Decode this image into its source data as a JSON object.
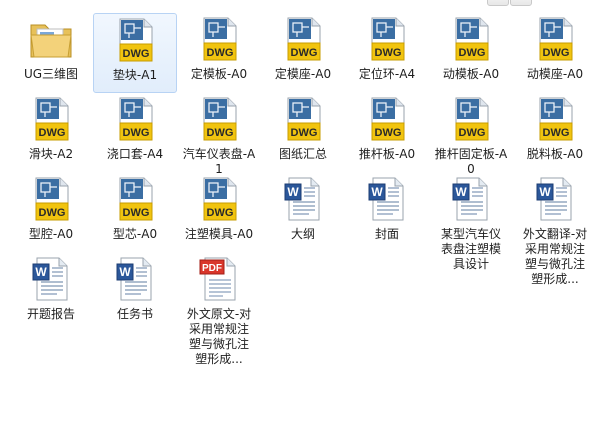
{
  "window": {
    "controls": [
      "minimize",
      "maximize"
    ]
  },
  "items": [
    {
      "label": "UG三维图",
      "type": "folder",
      "icon": "folder-icon"
    },
    {
      "label": "垫块-A1",
      "type": "dwg",
      "icon": "dwg-file-icon",
      "badge": "DWG",
      "selected": true
    },
    {
      "label": "定模板-A0",
      "type": "dwg",
      "icon": "dwg-file-icon",
      "badge": "DWG"
    },
    {
      "label": "定模座-A0",
      "type": "dwg",
      "icon": "dwg-file-icon",
      "badge": "DWG"
    },
    {
      "label": "定位环-A4",
      "type": "dwg",
      "icon": "dwg-file-icon",
      "badge": "DWG"
    },
    {
      "label": "动模板-A0",
      "type": "dwg",
      "icon": "dwg-file-icon",
      "badge": "DWG"
    },
    {
      "label": "动模座-A0",
      "type": "dwg",
      "icon": "dwg-file-icon",
      "badge": "DWG"
    },
    {
      "label": "滑块-A2",
      "type": "dwg",
      "icon": "dwg-file-icon",
      "badge": "DWG"
    },
    {
      "label": "浇口套-A4",
      "type": "dwg",
      "icon": "dwg-file-icon",
      "badge": "DWG"
    },
    {
      "label": "汽车仪表盘-A1",
      "type": "dwg",
      "icon": "dwg-file-icon",
      "badge": "DWG"
    },
    {
      "label": "图纸汇总",
      "type": "dwg",
      "icon": "dwg-file-icon",
      "badge": "DWG"
    },
    {
      "label": "推杆板-A0",
      "type": "dwg",
      "icon": "dwg-file-icon",
      "badge": "DWG"
    },
    {
      "label": "推杆固定板-A0",
      "type": "dwg",
      "icon": "dwg-file-icon",
      "badge": "DWG"
    },
    {
      "label": "脱料板-A0",
      "type": "dwg",
      "icon": "dwg-file-icon",
      "badge": "DWG"
    },
    {
      "label": "型腔-A0",
      "type": "dwg",
      "icon": "dwg-file-icon",
      "badge": "DWG"
    },
    {
      "label": "型芯-A0",
      "type": "dwg",
      "icon": "dwg-file-icon",
      "badge": "DWG"
    },
    {
      "label": "注塑模具-A0",
      "type": "dwg",
      "icon": "dwg-file-icon",
      "badge": "DWG"
    },
    {
      "label": "大纲",
      "type": "word",
      "icon": "word-document-icon"
    },
    {
      "label": "封面",
      "type": "word",
      "icon": "word-document-icon"
    },
    {
      "label": "某型汽车仪表盘注塑模具设计",
      "type": "word",
      "icon": "word-document-icon"
    },
    {
      "label": "外文翻译-对采用常规注塑与微孔注塑形成...",
      "type": "word",
      "icon": "word-document-icon"
    },
    {
      "label": "开题报告",
      "type": "word",
      "icon": "word-document-icon"
    },
    {
      "label": "任务书",
      "type": "word",
      "icon": "word-document-icon"
    },
    {
      "label": "外文原文-对采用常规注塑与微孔注塑形成...",
      "type": "pdf",
      "icon": "pdf-document-icon",
      "badge": "PDF"
    }
  ],
  "colors": {
    "dwg_badge_bg": "#f1c40f",
    "dwg_header": "#2f5f8f",
    "word_blue": "#2b579a",
    "pdf_red": "#d9362b",
    "selection_border": "#b8d3f4"
  }
}
